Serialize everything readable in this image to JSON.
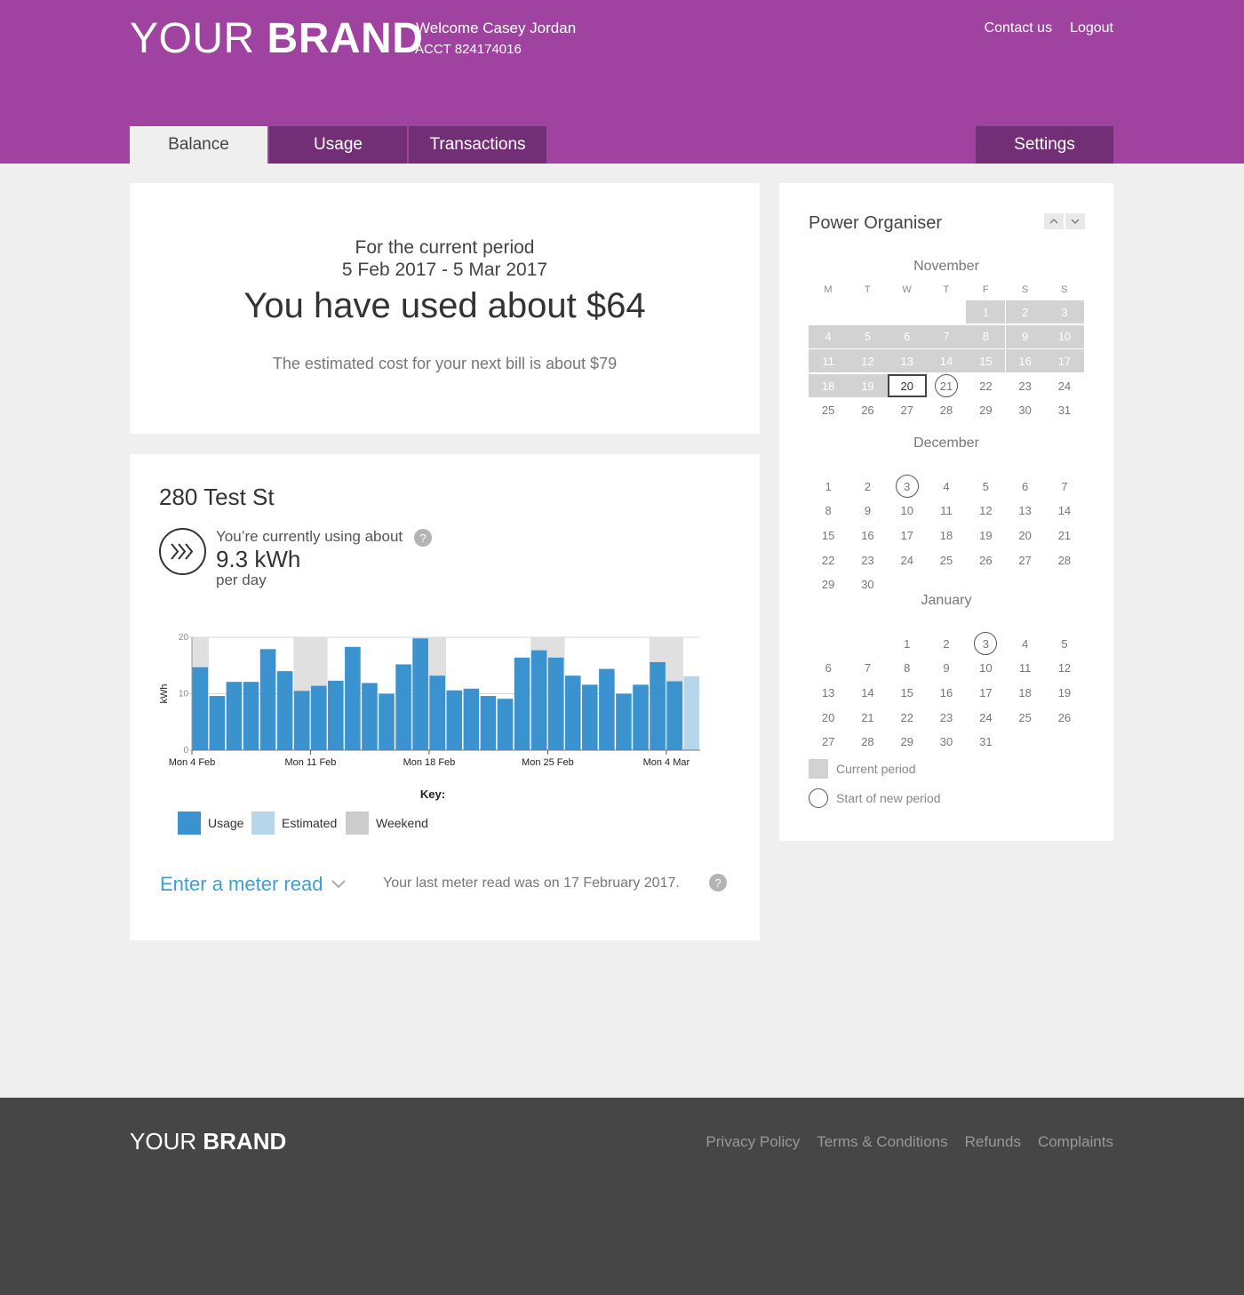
{
  "header": {
    "brand_light": "YOUR",
    "brand_bold": "BRAND",
    "welcome": "Welcome Casey Jordan",
    "account": "ACCT 824174016",
    "links": [
      "Contact us",
      "Logout"
    ],
    "tabs": [
      "Balance",
      "Usage",
      "Transactions"
    ],
    "settings": "Settings",
    "accent_color": "#9f42a0"
  },
  "balance": {
    "period_label": "For the current period",
    "period_dates": "5 Feb 2017 - 5 Mar 2017",
    "headline": "You have used about $64",
    "estimate": "The estimated cost for your next bill is about $79"
  },
  "usage": {
    "address": "280 Test St",
    "using_label": "You’re currently using about",
    "value": "9.3 kWh",
    "per": "per day",
    "help_icon": "?",
    "meter_link": "Enter a meter read",
    "meter_note": "Your last meter read was on 17 February 2017."
  },
  "chart_data": {
    "type": "bar",
    "ylabel": "kWh",
    "ylim": [
      0,
      20
    ],
    "yticks": [
      "20",
      "10",
      "0"
    ],
    "xtick_labels": [
      "Mon  4 Feb",
      "Mon 11 Feb",
      "Mon 18 Feb",
      "Mon 25 Feb",
      "Mon  4 Mar"
    ],
    "key_title": "Key:",
    "legend": [
      {
        "name": "Usage",
        "color": "#3a93cf"
      },
      {
        "name": "Estimated",
        "color": "#b6d6ec"
      },
      {
        "name": "Weekend",
        "color": "#cccccc"
      }
    ],
    "values": [
      14.7,
      9.6,
      12.1,
      12.1,
      17.9,
      14.0,
      10.5,
      11.4,
      12.3,
      18.3,
      11.9,
      10.0,
      15.2,
      19.8,
      13.2,
      10.6,
      10.9,
      9.6,
      9.1,
      16.4,
      17.7,
      16.4,
      13.2,
      11.6,
      14.4,
      10.0,
      11.6,
      15.6,
      12.2,
      13.1
    ],
    "estimated": [
      false,
      false,
      false,
      false,
      false,
      false,
      false,
      false,
      false,
      false,
      false,
      false,
      false,
      false,
      false,
      false,
      false,
      false,
      false,
      false,
      false,
      false,
      false,
      false,
      false,
      false,
      false,
      false,
      false,
      true
    ],
    "weekend_days": [
      0,
      6,
      7,
      13,
      14,
      20,
      21,
      27,
      28
    ]
  },
  "calendar": {
    "title": "Power Organiser",
    "weekday_headers": [
      "M",
      "T",
      "W",
      "T",
      "F",
      "S",
      "S"
    ],
    "months": [
      {
        "name": "November",
        "start_col": 4,
        "days": 31,
        "shaded_through": 19,
        "today": 20,
        "ringed": [
          21
        ]
      },
      {
        "name": "December",
        "start_col": 0,
        "days": 30,
        "shaded_through": 0,
        "today": 0,
        "ringed": [
          3
        ]
      },
      {
        "name": "January",
        "start_col": 2,
        "days": 31,
        "shaded_through": 0,
        "today": 0,
        "ringed": [
          3
        ]
      }
    ],
    "legend_current": "Current period",
    "legend_new": "Start of new period"
  },
  "footer": {
    "brand_light": "YOUR",
    "brand_bold": "BRAND",
    "links": [
      "Privacy Policy",
      "Terms & Conditions",
      "Refunds",
      "Complaints"
    ]
  }
}
